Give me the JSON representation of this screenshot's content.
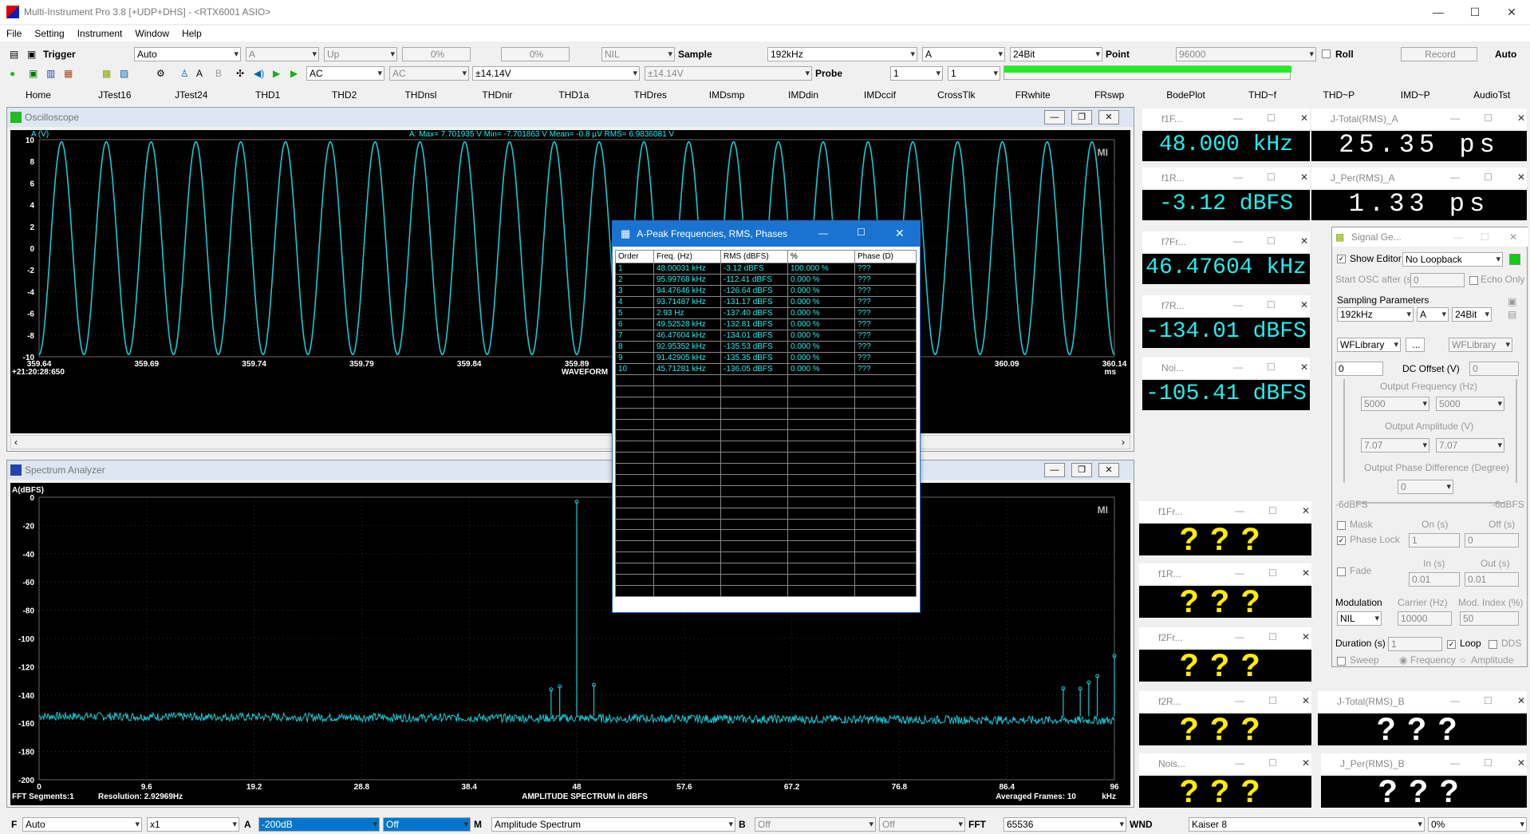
{
  "app": {
    "title": "Multi-Instrument Pro 3.8    [+UDP+DHS]    -   <RTX6001 ASIO>"
  },
  "menu": [
    "File",
    "Setting",
    "Instrument",
    "Window",
    "Help"
  ],
  "toolbar1": {
    "trigger": "Trigger",
    "trig_mode": "Auto",
    "channel": "A",
    "edge": "Up",
    "pct1": "0%",
    "pct2": "0%",
    "nil": "NIL",
    "sample_lbl": "Sample",
    "sample_rate": "192kHz",
    "ch2": "A",
    "bits": "24Bit",
    "point_lbl": "Point",
    "points": "96000",
    "roll": "Roll",
    "record": "Record",
    "auto": "Auto"
  },
  "toolbar2": {
    "coupling": "AC",
    "coupling2": "AC",
    "range": "±14.14V",
    "range2": "±14.14V",
    "probe_lbl": "Probe",
    "probe": "1",
    "probe2": "1"
  },
  "tabs": [
    "Home",
    "JTest16",
    "JTest24",
    "THD1",
    "THD2",
    "THDnsl",
    "THDnir",
    "THD1a",
    "THDres",
    "IMDsmp",
    "IMDdin",
    "IMDccif",
    "CrossTlk",
    "FRwhite",
    "FRswp",
    "BodePlot",
    "THD~f",
    "THD~P",
    "IMD~P",
    "AudioTst"
  ],
  "osc": {
    "title": "Oscilloscope",
    "unit": "A (V)",
    "stats": "A: Max=     7.701935   V  Min=     -7.701863   V  Mean=          -0.8   µV  RMS=     6.9836081   V",
    "yticks": [
      "10",
      "8",
      "6",
      "4",
      "2",
      "0",
      "-2",
      "-4",
      "-6",
      "-8",
      "-10"
    ],
    "xticks": [
      "359.64",
      "359.69",
      "359.74",
      "359.79",
      "359.84",
      "359.89",
      "",
      "",
      "",
      "360.09",
      "360.14"
    ],
    "time": "+21:20:28:650",
    "xlabel": "WAVEFORM",
    "xunit": "ms",
    "mi": "MI"
  },
  "spec": {
    "title": "Spectrum Analyzer",
    "unit": "A(dBFS)",
    "yticks": [
      "0",
      "-20",
      "-40",
      "-60",
      "-80",
      "-100",
      "-120",
      "-140",
      "-160",
      "-180",
      "-200"
    ],
    "xticks": [
      "0",
      "9.6",
      "19.2",
      "28.8",
      "38.4",
      "48",
      "57.6",
      "67.2",
      "76.8",
      "86.4",
      "96"
    ],
    "segments": "FFT Segments:1",
    "resolution": "Resolution: 2.92969Hz",
    "xlabel": "AMPLITUDE SPECTRUM in dBFS",
    "frames": "Averaged Frames: 10",
    "xunit": "kHz",
    "mi": "MI"
  },
  "meters": [
    {
      "head": "f1F...",
      "value": "48.000 kHz"
    },
    {
      "head": "J-Total(RMS)_A",
      "value": "25.35 ps"
    },
    {
      "head": "f1R...",
      "value": "-3.12 dBFS"
    },
    {
      "head": "J_Per(RMS)_A",
      "value": "1.33 ps"
    },
    {
      "head": "f7Fr...",
      "value": "46.47604 kHz"
    },
    {
      "head": "f7R...",
      "value": "-134.01 dBFS"
    },
    {
      "head": "Noi...",
      "value": "-105.41 dBFS"
    }
  ],
  "qmeters": [
    {
      "head": "f1Fr...",
      "value": "???"
    },
    {
      "head": "f1R...",
      "value": "???"
    },
    {
      "head": "f2Fr...",
      "value": "???"
    },
    {
      "head": "f2R...",
      "value": "???"
    },
    {
      "head": "J-Total(RMS)_B",
      "value": "???"
    },
    {
      "head": "Nois...",
      "value": "???"
    },
    {
      "head": "J_Per(RMS)_B",
      "value": "???"
    }
  ],
  "peaks": {
    "title": "A-Peak Frequencies, RMS, Phases",
    "headers": [
      "Order",
      "Freq. (Hz)",
      "RMS (dBFS)",
      "%",
      "Phase (D)"
    ],
    "rows": [
      [
        "1",
        "48.00031 kHz",
        "-3.12 dBFS",
        "100.000  %",
        "???"
      ],
      [
        "2",
        "95.99768 kHz",
        "-112.41 dBFS",
        "0.000  %",
        "???"
      ],
      [
        "3",
        "94.47646 kHz",
        "-126.64 dBFS",
        "0.000  %",
        "???"
      ],
      [
        "4",
        "93.71487 kHz",
        "-131.17 dBFS",
        "0.000  %",
        "???"
      ],
      [
        "5",
        "2.93 Hz",
        "-137.40 dBFS",
        "0.000  %",
        "???"
      ],
      [
        "6",
        "49.52528 kHz",
        "-132.81 dBFS",
        "0.000  %",
        "???"
      ],
      [
        "7",
        "46.47604 kHz",
        "-134.01 dBFS",
        "0.000  %",
        "???"
      ],
      [
        "8",
        "92.95352 kHz",
        "-135.53 dBFS",
        "0.000  %",
        "???"
      ],
      [
        "9",
        "91.42905 kHz",
        "-135.35 dBFS",
        "0.000  %",
        "???"
      ],
      [
        "10",
        "45.71281 kHz",
        "-136.05 dBFS",
        "0.000  %",
        "???"
      ]
    ]
  },
  "siggen": {
    "title": "Signal Ge...",
    "show_editor": "Show Editor",
    "loopback": "No Loopback",
    "start_osc": "Start OSC after (s)",
    "start_val": "0",
    "echo": "Echo Only",
    "sampling": "Sampling Parameters",
    "rate": "192kHz",
    "ch": "A",
    "bits": "24Bit",
    "wf1": "WFLibrary",
    "wf2": "WFLibrary",
    "dc_val": "0",
    "dc_lbl": "DC Offset (V)",
    "dc_val2": "0",
    "out_freq": "Output Frequency (Hz)",
    "f1": "5000",
    "f2": "5000",
    "out_amp": "Output Amplitude (V)",
    "a1": "7.07",
    "a2": "7.07",
    "phase_diff": "Output Phase Difference (Degree)",
    "ph": "0",
    "db1": "-6dBFS",
    "db2": "-6dBFS",
    "mask": "Mask",
    "on": "On (s)",
    "off": "Off (s)",
    "phase_lock": "Phase Lock",
    "pl_on": "1",
    "pl_off": "0",
    "fade": "Fade",
    "in": "In (s)",
    "out": "Out (s)",
    "fin": "0.01",
    "fout": "0.01",
    "modulation": "Modulation",
    "carrier": "Carrier (Hz)",
    "modidx": "Mod. Index (%)",
    "mod": "NIL",
    "carrier_v": "10000",
    "modidx_v": "50",
    "duration": "Duration (s)",
    "dur_v": "1",
    "loop": "Loop",
    "dds": "DDS",
    "sweep": "Sweep",
    "freq": "Frequency",
    "amp": "Amplitude"
  },
  "bottom": {
    "f": "F",
    "mode": "Auto",
    "mult": "x1",
    "a": "A",
    "db": "-200dB",
    "off": "Off",
    "m": "M",
    "spectrum": "Amplitude Spectrum",
    "b": "B",
    "boff": "Off",
    "boff2": "Off",
    "fft_lbl": "FFT",
    "fft": "65536",
    "wnd_lbl": "WND",
    "wnd": "Kaiser 8",
    "pct": "0%"
  },
  "chart_data": [
    {
      "type": "line",
      "title": "Oscilloscope",
      "ylabel": "A (V)",
      "xlabel": "WAVEFORM",
      "xunit": "ms",
      "xlim": [
        359.64,
        360.14
      ],
      "ylim": [
        -10,
        10
      ],
      "series": [
        {
          "name": "A",
          "frequency_hz": 48000,
          "amplitude_v": 9.8
        }
      ]
    },
    {
      "type": "line",
      "title": "Spectrum Analyzer",
      "ylabel": "A(dBFS)",
      "xlabel": "AMPLITUDE SPECTRUM in dBFS",
      "xunit": "kHz",
      "xlim": [
        0,
        96
      ],
      "ylim": [
        -200,
        0
      ],
      "noise_floor": -155,
      "peaks": [
        {
          "x": 48.0,
          "y": -3.12
        },
        {
          "x": 45.71,
          "y": -136.05
        },
        {
          "x": 46.48,
          "y": -134.01
        },
        {
          "x": 49.53,
          "y": -132.81
        },
        {
          "x": 91.43,
          "y": -135.35
        },
        {
          "x": 92.95,
          "y": -135.53
        },
        {
          "x": 93.71,
          "y": -131.17
        },
        {
          "x": 94.48,
          "y": -126.64
        },
        {
          "x": 96.0,
          "y": -112.41
        }
      ]
    }
  ]
}
